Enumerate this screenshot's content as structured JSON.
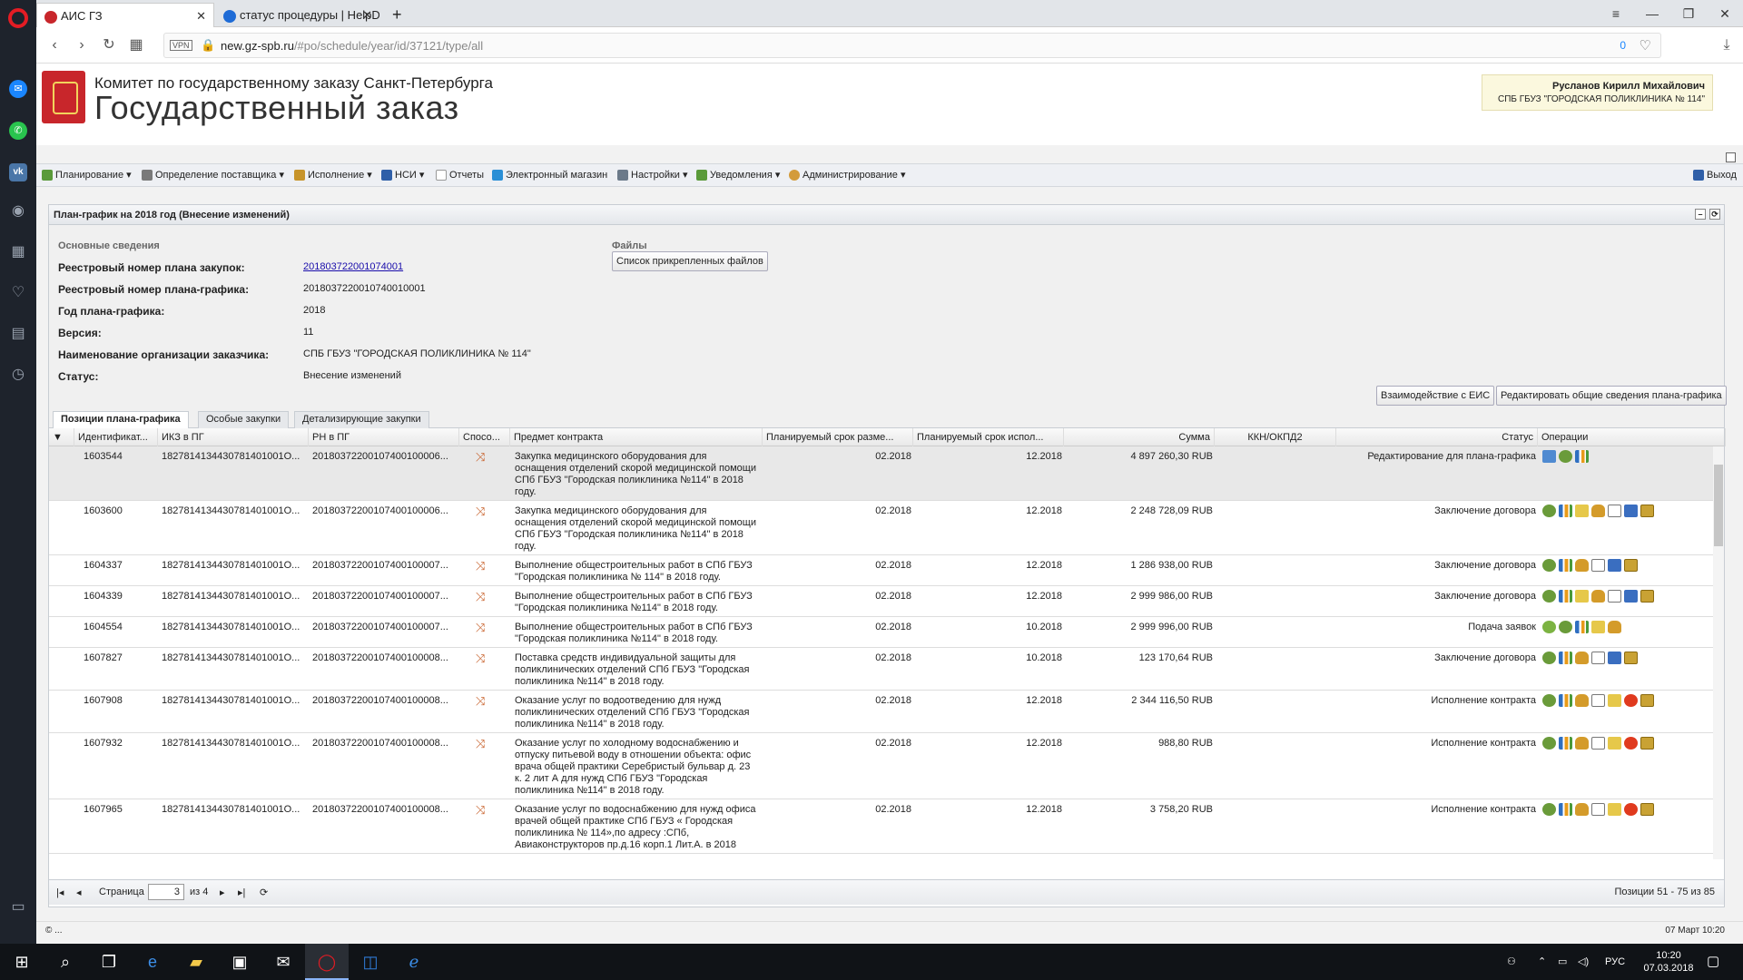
{
  "browser": {
    "tabs": [
      {
        "title": "АИС ГЗ",
        "active": true
      },
      {
        "title": "статус процедуры | HelpD",
        "active": false
      }
    ],
    "new_tab": "+",
    "url_host": "new.gz-spb.ru",
    "url_path": "/#po/schedule/year/id/37121/type/all",
    "vpn_label": "VPN",
    "blocked_count": "0"
  },
  "header": {
    "org_line": "Комитет по государственному заказу Санкт-Петербурга",
    "site_title": "Государственный заказ",
    "user_name": "Русланов Кирилл Михайлович",
    "user_org": "СПБ ГБУЗ \"ГОРОДСКАЯ ПОЛИКЛИНИКА № 114\""
  },
  "menu": {
    "items": [
      "Планирование",
      "Определение поставщика",
      "Исполнение",
      "НСИ",
      "Отчеты",
      "Электронный магазин",
      "Настройки",
      "Уведомления",
      "Администрирование"
    ],
    "logout": "Выход"
  },
  "panel": {
    "title": "План-график на 2018 год (Внесение изменений)",
    "main_section": "Основные сведения",
    "files_section": "Файлы",
    "files_button": "Список прикрепленных файлов",
    "fields": [
      {
        "label": "Реестровый номер плана закупок:",
        "value": "201803722001074001",
        "link": true
      },
      {
        "label": "Реестровый номер плана-графика:",
        "value": "2018037220010740010001",
        "link": false
      },
      {
        "label": "Год плана-графика:",
        "value": "2018",
        "link": false
      },
      {
        "label": "Версия:",
        "value": "11",
        "link": false
      },
      {
        "label": "Наименование организации заказчика:",
        "value": "СПБ ГБУЗ \"ГОРОДСКАЯ ПОЛИКЛИНИКА № 114\"",
        "link": false
      },
      {
        "label": "Статус:",
        "value": "Внесение изменений",
        "link": false
      }
    ],
    "btn_eis": "Взаимодействие с ЕИС",
    "btn_edit": "Редактировать общие сведения плана-графика"
  },
  "grid_tabs": [
    "Позиции плана-графика",
    "Особые закупки",
    "Детализирующие закупки"
  ],
  "columns": [
    "Идентификат...",
    "ИКЗ в ПГ",
    "РН в ПГ",
    "Спосо...",
    "Предмет контракта",
    "Планируемый срок разме...",
    "Планируемый срок испол...",
    "Сумма",
    "ККН/ОКПД2",
    "Статус",
    "Операции"
  ],
  "rows": [
    {
      "id": "1603544",
      "ikz": "1827814134430781401001О...",
      "rn": "20180372200107400100006...",
      "subject": "Закупка медицинского оборудования для оснащения отделений скорой медицинской помощи СПб ГБУЗ \"Городская поликлиника №114\" в 2018 году.",
      "start": "02.2018",
      "end": "12.2018",
      "sum": "4 897 260,30 RUB",
      "status": "Редактирование для плана-графика",
      "ops": [
        "map",
        "gear",
        "chart"
      ],
      "selected": true
    },
    {
      "id": "1603600",
      "ikz": "1827814134430781401001О...",
      "rn": "20180372200107400100006...",
      "subject": "Закупка медицинского оборудования для оснащения отделений скорой медицинской помощи СПб ГБУЗ \"Городская поликлиника №114\" в 2018 году.",
      "start": "02.2018",
      "end": "12.2018",
      "sum": "2 248 728,09 RUB",
      "status": "Заключение договора",
      "ops": [
        "gear",
        "chart",
        "scroll",
        "eagle",
        "doc",
        "save",
        "book"
      ],
      "selected": false
    },
    {
      "id": "1604337",
      "ikz": "1827814134430781401001О...",
      "rn": "20180372200107400100007...",
      "subject": "Выполнение общестроительных работ в СПб ГБУЗ \"Городская поликлиника № 114\" в 2018 году.",
      "start": "02.2018",
      "end": "12.2018",
      "sum": "1 286 938,00 RUB",
      "status": "Заключение договора",
      "ops": [
        "gear",
        "chart",
        "eagle",
        "doc",
        "save",
        "book"
      ],
      "selected": false
    },
    {
      "id": "1604339",
      "ikz": "1827814134430781401001О...",
      "rn": "20180372200107400100007...",
      "subject": "Выполнение общестроительных работ в СПб ГБУЗ \"Городская поликлиника №114\" в 2018 году.",
      "start": "02.2018",
      "end": "12.2018",
      "sum": "2 999 986,00 RUB",
      "status": "Заключение договора",
      "ops": [
        "gear",
        "chart",
        "scroll",
        "eagle",
        "doc",
        "save",
        "book"
      ],
      "selected": false
    },
    {
      "id": "1604554",
      "ikz": "1827814134430781401001О...",
      "rn": "20180372200107400100007...",
      "subject": "Выполнение общестроительных работ в СПб ГБУЗ \"Городская поликлиника №114\" в 2018 году.",
      "start": "02.2018",
      "end": "10.2018",
      "sum": "2 999 996,00 RUB",
      "status": "Подача заявок",
      "ops": [
        "green",
        "gear",
        "chart",
        "scroll",
        "eagle"
      ],
      "selected": false
    },
    {
      "id": "1607827",
      "ikz": "1827814134430781401001О...",
      "rn": "20180372200107400100008...",
      "subject": "Поставка средств индивидуальной защиты для поликлинических отделений СПб ГБУЗ \"Городская поликлиника №114\" в 2018 году.",
      "start": "02.2018",
      "end": "10.2018",
      "sum": "123 170,64 RUB",
      "status": "Заключение договора",
      "ops": [
        "gear",
        "chart",
        "eagle",
        "doc",
        "save",
        "book"
      ],
      "selected": false
    },
    {
      "id": "1607908",
      "ikz": "1827814134430781401001О...",
      "rn": "20180372200107400100008...",
      "subject": "Оказание услуг по водоотведению для нужд поликлинических отделений СПб ГБУЗ \"Городская поликлиника №114\" в 2018 году.",
      "start": "02.2018",
      "end": "12.2018",
      "sum": "2 344 116,50 RUB",
      "status": "Исполнение контракта",
      "ops": [
        "gear",
        "chart",
        "eagle",
        "doc",
        "scroll",
        "stop",
        "book"
      ],
      "selected": false
    },
    {
      "id": "1607932",
      "ikz": "1827814134430781401001О...",
      "rn": "20180372200107400100008...",
      "subject": "Оказание услуг по холодному водоснабжению и отпуску питьевой воду в отношении объекта: офис врача общей практики Серебристый бульвар д. 23 к. 2 лит А для нужд СПб ГБУЗ \"Городская поликлиника №114\" в 2018 году.",
      "start": "02.2018",
      "end": "12.2018",
      "sum": "988,80 RUB",
      "status": "Исполнение контракта",
      "ops": [
        "gear",
        "chart",
        "eagle",
        "doc",
        "scroll",
        "stop",
        "book"
      ],
      "selected": false
    },
    {
      "id": "1607965",
      "ikz": "1827814134430781401001О...",
      "rn": "20180372200107400100008...",
      "subject": "Оказание услуг по водоснабжению для нужд офиса врачей общей практике СПб ГБУЗ « Городская поликлиника № 114»,по адресу :СПб, Авиаконструкторов пр.д.16 корп.1 Лит.А. в 2018",
      "start": "02.2018",
      "end": "12.2018",
      "sum": "3 758,20 RUB",
      "status": "Исполнение контракта",
      "ops": [
        "gear",
        "chart",
        "eagle",
        "doc",
        "scroll",
        "stop",
        "book"
      ],
      "selected": false
    }
  ],
  "pager": {
    "page_label": "Страница",
    "page": "3",
    "of": "из 4",
    "summary": "Позиции 51 - 75 из 85"
  },
  "footer": {
    "copyright": "© ...",
    "datetime": "07 Март 10:20"
  },
  "taskbar": {
    "lang": "РУС",
    "time": "10:20",
    "date": "07.03.2018"
  }
}
